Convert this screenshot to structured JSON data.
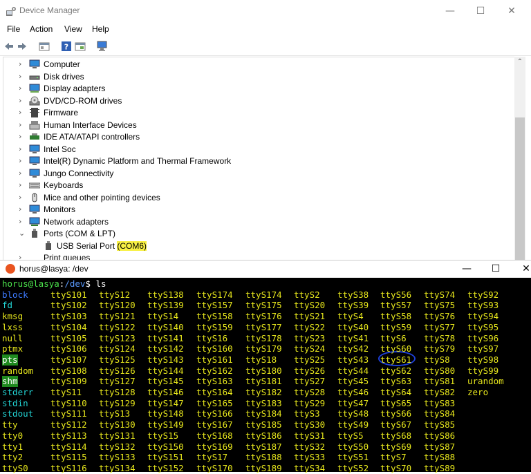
{
  "device_manager": {
    "title": "Device Manager",
    "window_buttons": {
      "minimize": "—",
      "maximize": "☐",
      "close": "✕"
    },
    "menu": [
      "File",
      "Action",
      "View",
      "Help"
    ],
    "tree": [
      {
        "label": "Computer",
        "icon": "monitor-icon",
        "state": "collapsed"
      },
      {
        "label": "Disk drives",
        "icon": "disk-drive-icon",
        "state": "collapsed"
      },
      {
        "label": "Display adapters",
        "icon": "display-adapter-icon",
        "state": "collapsed"
      },
      {
        "label": "DVD/CD-ROM drives",
        "icon": "dvd-icon",
        "state": "collapsed"
      },
      {
        "label": "Firmware",
        "icon": "firmware-icon",
        "state": "collapsed"
      },
      {
        "label": "Human Interface Devices",
        "icon": "hid-icon",
        "state": "collapsed"
      },
      {
        "label": "IDE ATA/ATAPI controllers",
        "icon": "ide-controller-icon",
        "state": "collapsed"
      },
      {
        "label": "Intel Soc",
        "icon": "monitor-icon",
        "state": "collapsed"
      },
      {
        "label": "Intel(R) Dynamic Platform and Thermal Framework",
        "icon": "monitor-icon",
        "state": "collapsed"
      },
      {
        "label": "Jungo Connectivity",
        "icon": "monitor-icon",
        "state": "collapsed"
      },
      {
        "label": "Keyboards",
        "icon": "keyboard-icon",
        "state": "collapsed"
      },
      {
        "label": "Mice and other pointing devices",
        "icon": "mouse-icon",
        "state": "collapsed"
      },
      {
        "label": "Monitors",
        "icon": "monitor-icon",
        "state": "collapsed"
      },
      {
        "label": "Network adapters",
        "icon": "network-adapter-icon",
        "state": "collapsed"
      },
      {
        "label": "Ports (COM & LPT)",
        "icon": "port-icon",
        "state": "expanded"
      }
    ],
    "port_child": {
      "label": "USB Serial Port ",
      "highlight": "(COM6)",
      "icon": "port-icon"
    },
    "partial_row": {
      "label": "Print queues"
    }
  },
  "terminal": {
    "title": "horus@lasya: /dev",
    "window_buttons": {
      "minimize": "—",
      "maximize": "☐",
      "close": "✕"
    },
    "prompt": {
      "user": "horus@lasya",
      "sep": ":",
      "path": "/dev",
      "symbol": "$",
      "command": " ls"
    },
    "columns": [
      [
        {
          "t": "block",
          "c": "dir"
        },
        {
          "t": "fd",
          "c": "lnk"
        },
        {
          "t": "kmsg",
          "c": "tty"
        },
        {
          "t": "lxss",
          "c": "tty"
        },
        {
          "t": "null",
          "c": "tty"
        },
        {
          "t": "ptmx",
          "c": "tty"
        },
        {
          "t": "pts",
          "c": "hl"
        },
        {
          "t": "random",
          "c": "tty"
        },
        {
          "t": "shm",
          "c": "hl"
        },
        {
          "t": "stderr",
          "c": "lnk"
        },
        {
          "t": "stdin",
          "c": "lnk"
        },
        {
          "t": "stdout",
          "c": "lnk"
        },
        {
          "t": "tty",
          "c": "tty"
        },
        {
          "t": "tty0",
          "c": "tty"
        },
        {
          "t": "tty1",
          "c": "tty"
        },
        {
          "t": "tty2",
          "c": "tty"
        },
        {
          "t": "ttyS0",
          "c": "tty"
        }
      ],
      [
        {
          "t": "ttyS101"
        },
        {
          "t": "ttyS102"
        },
        {
          "t": "ttyS103"
        },
        {
          "t": "ttyS104"
        },
        {
          "t": "ttyS105"
        },
        {
          "t": "ttyS106"
        },
        {
          "t": "ttyS107"
        },
        {
          "t": "ttyS108"
        },
        {
          "t": "ttyS109"
        },
        {
          "t": "ttyS11"
        },
        {
          "t": "ttyS110"
        },
        {
          "t": "ttyS111"
        },
        {
          "t": "ttyS112"
        },
        {
          "t": "ttyS113"
        },
        {
          "t": "ttyS114"
        },
        {
          "t": "ttyS115"
        },
        {
          "t": "ttyS116"
        }
      ],
      [
        {
          "t": "ttyS12"
        },
        {
          "t": "ttyS120"
        },
        {
          "t": "ttyS121"
        },
        {
          "t": "ttyS122"
        },
        {
          "t": "ttyS123"
        },
        {
          "t": "ttyS124"
        },
        {
          "t": "ttyS125"
        },
        {
          "t": "ttyS126"
        },
        {
          "t": "ttyS127"
        },
        {
          "t": "ttyS128"
        },
        {
          "t": "ttyS129"
        },
        {
          "t": "ttyS13"
        },
        {
          "t": "ttyS130"
        },
        {
          "t": "ttyS131"
        },
        {
          "t": "ttyS132"
        },
        {
          "t": "ttyS133"
        },
        {
          "t": "ttyS134"
        }
      ],
      [
        {
          "t": "ttyS138"
        },
        {
          "t": "ttyS139"
        },
        {
          "t": "ttyS14"
        },
        {
          "t": "ttyS140"
        },
        {
          "t": "ttyS141"
        },
        {
          "t": "ttyS142"
        },
        {
          "t": "ttyS143"
        },
        {
          "t": "ttyS144"
        },
        {
          "t": "ttyS145"
        },
        {
          "t": "ttyS146"
        },
        {
          "t": "ttyS147"
        },
        {
          "t": "ttyS148"
        },
        {
          "t": "ttyS149"
        },
        {
          "t": "ttyS15"
        },
        {
          "t": "ttyS150"
        },
        {
          "t": "ttyS151"
        },
        {
          "t": "ttyS152"
        }
      ],
      [
        {
          "t": "ttyS174"
        },
        {
          "t": "ttyS157"
        },
        {
          "t": "ttyS158"
        },
        {
          "t": "ttyS159"
        },
        {
          "t": "ttyS16"
        },
        {
          "t": "ttyS160"
        },
        {
          "t": "ttyS161"
        },
        {
          "t": "ttyS162"
        },
        {
          "t": "ttyS163"
        },
        {
          "t": "ttyS164"
        },
        {
          "t": "ttyS165"
        },
        {
          "t": "ttyS166"
        },
        {
          "t": "ttyS167"
        },
        {
          "t": "ttyS168"
        },
        {
          "t": "ttyS169"
        },
        {
          "t": "ttyS17"
        },
        {
          "t": "ttyS170"
        }
      ],
      [
        {
          "t": "ttyS174"
        },
        {
          "t": "ttyS175"
        },
        {
          "t": "ttyS176"
        },
        {
          "t": "ttyS177"
        },
        {
          "t": "ttyS178"
        },
        {
          "t": "ttyS179"
        },
        {
          "t": "ttyS18"
        },
        {
          "t": "ttyS180"
        },
        {
          "t": "ttyS181"
        },
        {
          "t": "ttyS182"
        },
        {
          "t": "ttyS183"
        },
        {
          "t": "ttyS184"
        },
        {
          "t": "ttyS185"
        },
        {
          "t": "ttyS186"
        },
        {
          "t": "ttyS187"
        },
        {
          "t": "ttyS188"
        },
        {
          "t": "ttyS189"
        }
      ],
      [
        {
          "t": "ttyS2"
        },
        {
          "t": "ttyS20"
        },
        {
          "t": "ttyS21"
        },
        {
          "t": "ttyS22"
        },
        {
          "t": "ttyS23"
        },
        {
          "t": "ttyS24"
        },
        {
          "t": "ttyS25"
        },
        {
          "t": "ttyS26"
        },
        {
          "t": "ttyS27"
        },
        {
          "t": "ttyS28"
        },
        {
          "t": "ttyS29"
        },
        {
          "t": "ttyS3"
        },
        {
          "t": "ttyS30"
        },
        {
          "t": "ttyS31"
        },
        {
          "t": "ttyS32"
        },
        {
          "t": "ttyS33"
        },
        {
          "t": "ttyS34"
        }
      ],
      [
        {
          "t": "ttyS38"
        },
        {
          "t": "ttyS39"
        },
        {
          "t": "ttyS4"
        },
        {
          "t": "ttyS40"
        },
        {
          "t": "ttyS41"
        },
        {
          "t": "ttyS42"
        },
        {
          "t": "ttyS43"
        },
        {
          "t": "ttyS44"
        },
        {
          "t": "ttyS45"
        },
        {
          "t": "ttyS46"
        },
        {
          "t": "ttyS47"
        },
        {
          "t": "ttyS48"
        },
        {
          "t": "ttyS49"
        },
        {
          "t": "ttyS5"
        },
        {
          "t": "ttyS50"
        },
        {
          "t": "ttyS51"
        },
        {
          "t": "ttyS52"
        }
      ],
      [
        {
          "t": "ttyS56"
        },
        {
          "t": "ttyS57"
        },
        {
          "t": "ttyS58"
        },
        {
          "t": "ttyS59"
        },
        {
          "t": "ttyS6"
        },
        {
          "t": "ttyS60"
        },
        {
          "t": "ttyS61"
        },
        {
          "t": "ttyS62"
        },
        {
          "t": "ttyS63"
        },
        {
          "t": "ttyS64"
        },
        {
          "t": "ttyS65"
        },
        {
          "t": "ttyS66"
        },
        {
          "t": "ttyS67"
        },
        {
          "t": "ttyS68"
        },
        {
          "t": "ttyS69"
        },
        {
          "t": "ttyS7"
        },
        {
          "t": "ttyS70"
        }
      ],
      [
        {
          "t": "ttyS74"
        },
        {
          "t": "ttyS75"
        },
        {
          "t": "ttyS76"
        },
        {
          "t": "ttyS77"
        },
        {
          "t": "ttyS78"
        },
        {
          "t": "ttyS79"
        },
        {
          "t": "ttyS8"
        },
        {
          "t": "ttyS80"
        },
        {
          "t": "ttyS81"
        },
        {
          "t": "ttyS82"
        },
        {
          "t": "ttyS83"
        },
        {
          "t": "ttyS84"
        },
        {
          "t": "ttyS85"
        },
        {
          "t": "ttyS86"
        },
        {
          "t": "ttyS87"
        },
        {
          "t": "ttyS88"
        },
        {
          "t": "ttyS89"
        }
      ],
      [
        {
          "t": "ttyS92"
        },
        {
          "t": "ttyS93"
        },
        {
          "t": "ttyS94"
        },
        {
          "t": "ttyS95"
        },
        {
          "t": "ttyS96"
        },
        {
          "t": "ttyS97"
        },
        {
          "t": "ttyS98"
        },
        {
          "t": "ttyS99"
        },
        {
          "t": "urandom"
        },
        {
          "t": "zero"
        }
      ]
    ]
  }
}
